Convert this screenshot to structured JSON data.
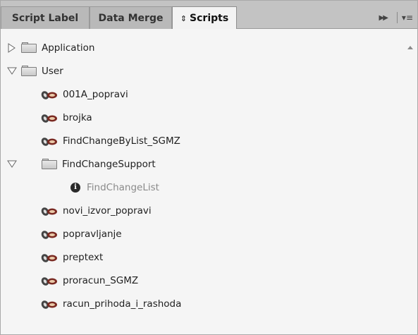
{
  "tabs": [
    {
      "label": "Script Label",
      "active": false
    },
    {
      "label": "Data Merge",
      "active": false
    },
    {
      "label": "Scripts",
      "active": true
    }
  ],
  "controls": {
    "fast_forward_icon": "double-chevron-right-icon",
    "menu_icon": "panel-menu-icon"
  },
  "tree": {
    "application": {
      "label": "Application"
    },
    "user": {
      "label": "User"
    },
    "items": [
      {
        "label": "001A_popravi"
      },
      {
        "label": "brojka"
      },
      {
        "label": "FindChangeByList_SGMZ"
      },
      {
        "label": "FindChangeSupport"
      },
      {
        "label": "FindChangeList"
      },
      {
        "label": "novi_izvor_popravi"
      },
      {
        "label": "popravljanje"
      },
      {
        "label": "preptext"
      },
      {
        "label": "proracun_SGMZ"
      },
      {
        "label": "racun_prihoda_i_rashoda"
      }
    ]
  },
  "colors": {
    "panel_bg": "#f3f3f3",
    "tabbar_bg": "#c3c3c3",
    "muted_text": "#8a8a8a"
  }
}
